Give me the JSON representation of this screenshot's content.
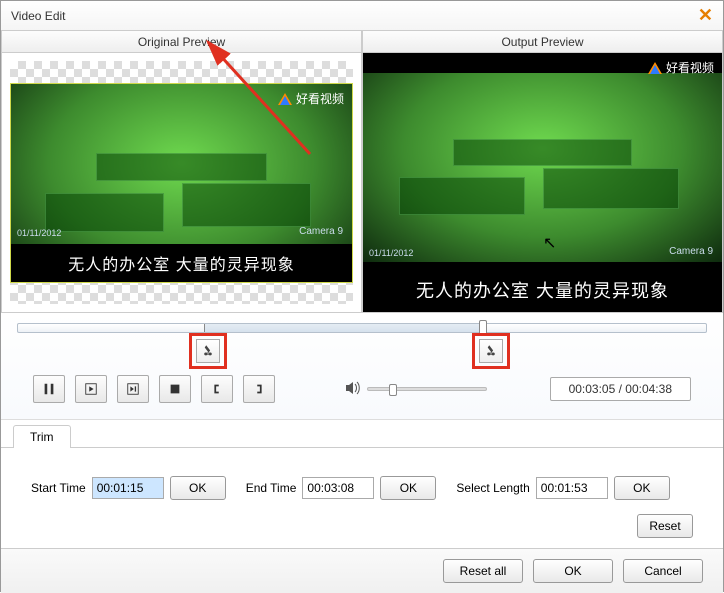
{
  "window": {
    "title": "Video Edit"
  },
  "previews": {
    "original": "Original Preview",
    "output": "Output Preview"
  },
  "video": {
    "caption": "无人的办公室 大量的灵异现象",
    "watermark": "好看视频",
    "camera_label": "Camera 9",
    "date": "01/11/2012"
  },
  "timeline": {
    "in_pct": 27,
    "out_pct": 68,
    "playhead_pct": 68
  },
  "playback": {
    "current": "00:03:05",
    "total": "00:04:38",
    "time_display": "00:03:05 / 00:04:38",
    "volume_pct": 18
  },
  "tabs": {
    "trim": "Trim"
  },
  "trim": {
    "start_label": "Start Time",
    "start_value": "00:01:15",
    "end_label": "End Time",
    "end_value": "00:03:08",
    "length_label": "Select Length",
    "length_value": "00:01:53",
    "ok": "OK",
    "reset": "Reset"
  },
  "footer": {
    "reset_all": "Reset all",
    "ok": "OK",
    "cancel": "Cancel"
  }
}
